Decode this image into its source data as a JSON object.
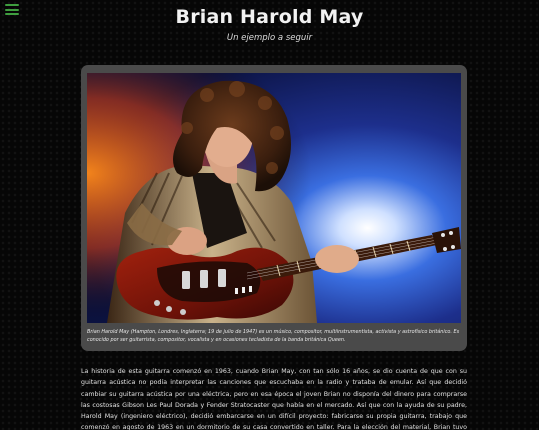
{
  "nav": {
    "menu_icon": "hamburger-menu-icon",
    "menu_color": "#3f9e3f"
  },
  "header": {
    "title": "Brian Harold May",
    "subtitle": "Un ejemplo a seguir"
  },
  "photo": {
    "subject": "Brian May playing a red electric guitar on stage",
    "caption": "Brian Harold May (Hampton, Londres, Inglaterra; 19 de julio de 1947) es un músico, compositor, multiinstrumentista, activista y astrofísico británico. Es conocido por ser guitarrista, compositor, vocalista y en ocasiones tecladista de la banda británica Queen."
  },
  "article": {
    "paragraph": "La historia de esta guitarra comenzó en 1963, cuando Brian May, con tan sólo 16 años, se dio cuenta de que con su guitarra acústica no podía interpretar las canciones que escuchaba en la radio y trataba de emular. Así que decidió cambiar su guitarra acústica por una eléctrica, pero en esa época el joven Brian no disponía del dinero para comprarse las costosas Gibson Les Paul Dorada y Fender Stratocaster que había en el mercado. Así que con la ayuda de su padre, Harold May (ingeniero eléctrico), decidió embarcarse en un difícil proyecto: fabricarse su propia guitarra, trabajo que comenzó en agosto de 1963 en un dormitorio de su casa convertido en taller. Para la elección del material, Brian tuvo que buscar"
  },
  "colors": {
    "background": "#060606",
    "card": "#4a4a4a",
    "text": "#e0e0e0"
  }
}
